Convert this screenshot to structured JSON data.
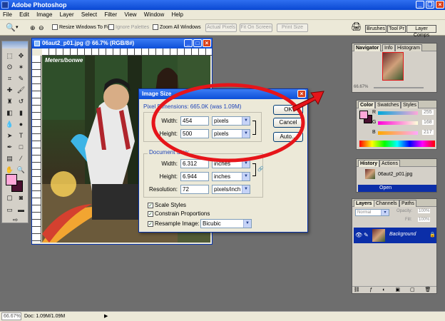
{
  "app": {
    "title": "Adobe Photoshop"
  },
  "menu": [
    "File",
    "Edit",
    "Image",
    "Layer",
    "Select",
    "Filter",
    "View",
    "Window",
    "Help"
  ],
  "options": {
    "resize_windows": "Resize Windows To Fit",
    "ignore_palettes": "Ignore Palettes",
    "zoom_all": "Zoom All Windows",
    "actual_pixels": "Actual Pixels",
    "fit_on_screen": "Fit On Screen",
    "print_size": "Print Size",
    "well_tabs": [
      "Brushes",
      "Tool Pr",
      "Layer Comps"
    ]
  },
  "document": {
    "title": "06aut2_p01.jpg @ 66.7% (RGB/8#)",
    "logo": "Meters/bonwe"
  },
  "panels": {
    "navigator": {
      "tabs": [
        "Navigator",
        "Info",
        "Histogram"
      ],
      "zoom": "66.67%"
    },
    "color": {
      "tabs": [
        "Color",
        "Swatches",
        "Styles"
      ],
      "channels": [
        {
          "label": "R",
          "value": "255"
        },
        {
          "label": "G",
          "value": "168"
        },
        {
          "label": "B",
          "value": "217"
        }
      ]
    },
    "history": {
      "tabs": [
        "History",
        "Actions"
      ],
      "items": [
        "06aut2_p01.jpg",
        "Open"
      ]
    },
    "layers": {
      "tabs": [
        "Layers",
        "Channels",
        "Paths"
      ],
      "blend_mode": "Normal",
      "opacity_label": "Opacity:",
      "opacity": "100%",
      "fill_label": "Fill:",
      "fill": "100%",
      "layer_name": "Background"
    }
  },
  "dialog": {
    "title": "Image Size",
    "pixel_dimensions": "Pixel Dimensions:  665.0K (was 1.09M)",
    "width_label": "Width:",
    "width_value": "454",
    "width_unit": "pixels",
    "height_label": "Height:",
    "height_value": "500",
    "height_unit": "pixels",
    "doc_size_label": "Document Size:",
    "doc_width_label": "Width:",
    "doc_width_value": "6.312",
    "doc_width_unit": "inches",
    "doc_height_label": "Height:",
    "doc_height_value": "6.944",
    "doc_height_unit": "inches",
    "resolution_label": "Resolution:",
    "resolution_value": "72",
    "resolution_unit": "pixels/inch",
    "scale_styles": "Scale Styles",
    "constrain": "Constrain Proportions",
    "resample_label": "Resample Image:",
    "resample_value": "Bicubic",
    "ok": "OK",
    "cancel": "Cancel",
    "auto": "Auto..."
  },
  "status": {
    "zoom": "66.67%",
    "doc": "Doc: 1.09M/1.09M"
  },
  "colors": {
    "foreground": "#ffa8d9",
    "background": "#4a1030",
    "highlight": "#e6151a",
    "title_blue": "#0d4fd8"
  }
}
